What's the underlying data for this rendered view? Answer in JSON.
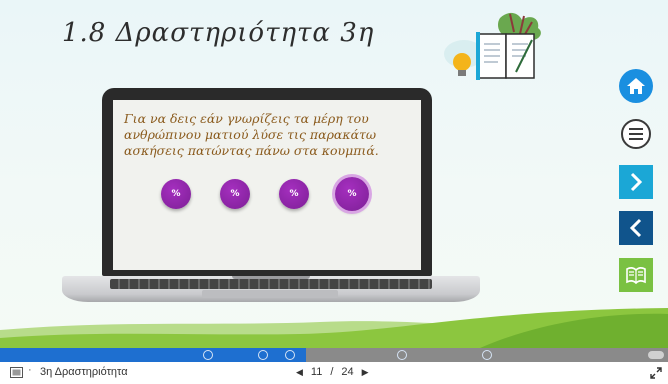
{
  "slide": {
    "title": "1.8 Δραστηριότητα 3η",
    "instruction": "Για να δεις εάν γνωρίζεις τα μέρη του ανθρώπινου ματιού λύσε τις παρακάτω ασκήσεις πατώντας πάνω στα κουμπιά."
  },
  "exercises": [
    {
      "icon": "percent-icon",
      "glyph": "%"
    },
    {
      "icon": "percent-icon",
      "glyph": "%"
    },
    {
      "icon": "percent-icon",
      "glyph": "%"
    },
    {
      "icon": "percent-icon",
      "glyph": "%"
    }
  ],
  "nav": {
    "home_icon": "home-icon",
    "menu_icon": "menu-icon",
    "next_icon": "chevron-right-icon",
    "prev_icon": "chevron-left-icon",
    "book_icon": "book-icon"
  },
  "progress": {
    "fraction": 0.458,
    "colors": {
      "fill": "#1e6fd0",
      "track": "#8a8a8a"
    }
  },
  "footer": {
    "deck_title": "3η Δραστηριότητα",
    "current_page": "11",
    "separator": "/",
    "total_pages": "24",
    "prev_symbol": "◀",
    "next_symbol": "▶"
  }
}
